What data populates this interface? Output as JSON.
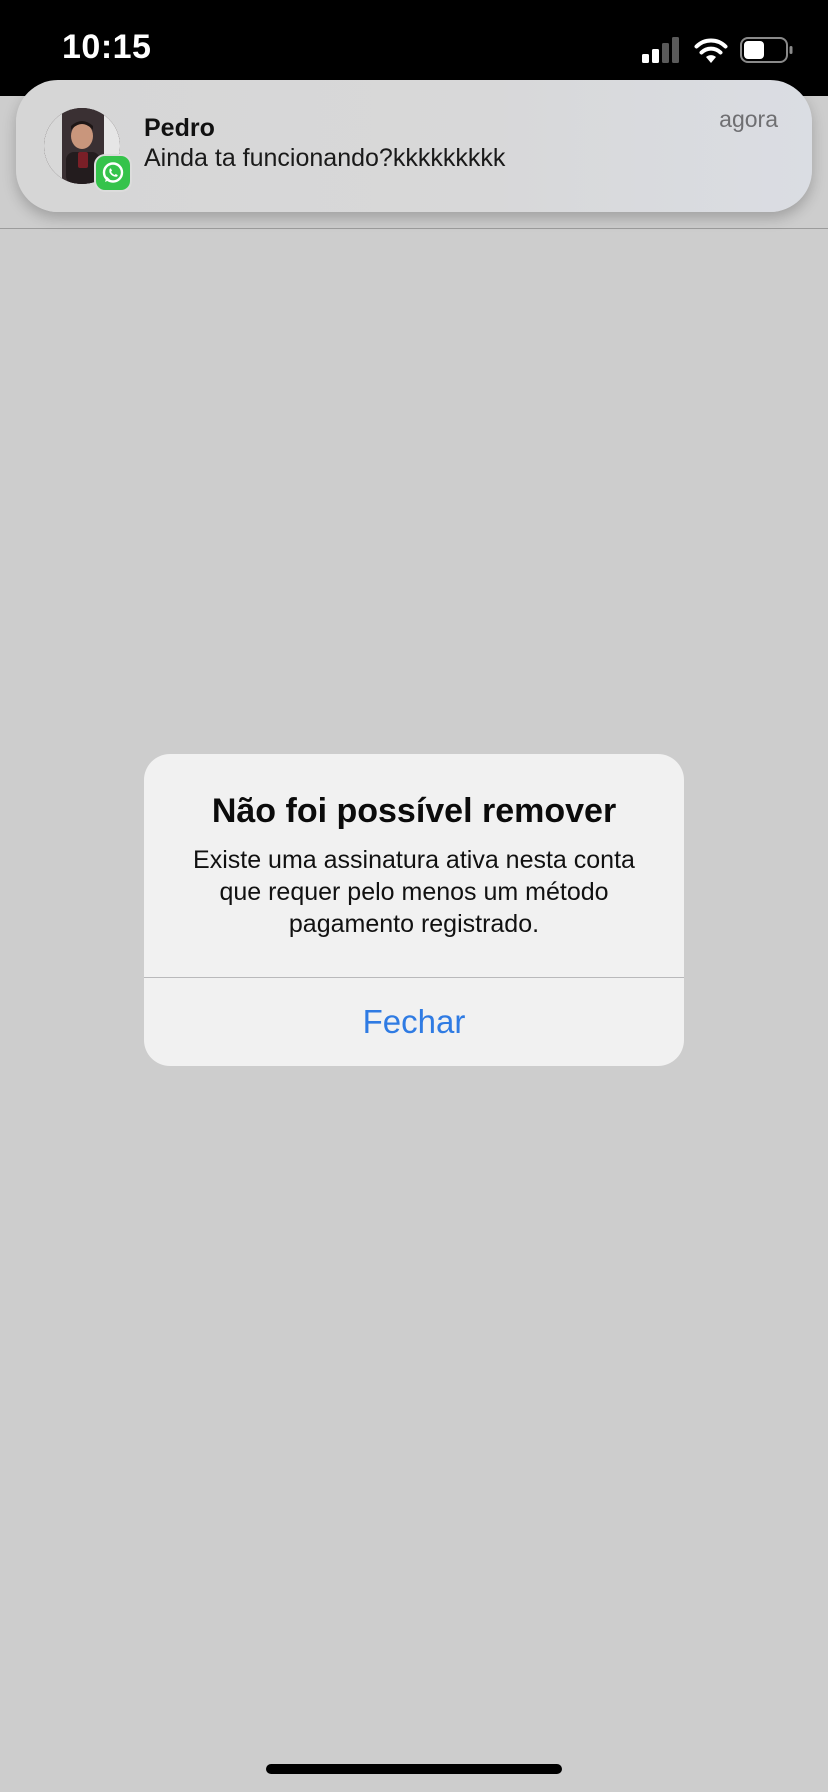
{
  "status_bar": {
    "time": "10:15",
    "icons": [
      "cellular-signal-icon",
      "wifi-icon",
      "battery-icon"
    ]
  },
  "notification": {
    "app_icon": "whatsapp-icon",
    "sender": "Pedro",
    "message": "Ainda ta funcionando?kkkkkkkkk",
    "time": "agora"
  },
  "alert": {
    "title": "Não foi possível remover",
    "message": "Existe uma assinatura ativa nesta conta que requer pelo menos um método pagamento registrado.",
    "button_label": "Fechar"
  },
  "colors": {
    "accent": "#2f7be3",
    "whatsapp": "#35c34b",
    "background": "#cdcdcd"
  }
}
